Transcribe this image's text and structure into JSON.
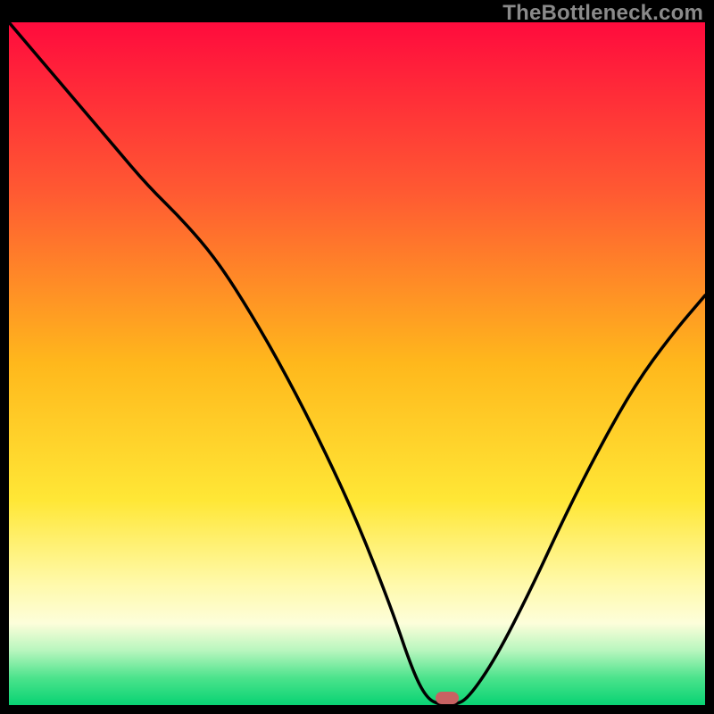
{
  "watermark": "TheBottleneck.com",
  "chart_data": {
    "type": "line",
    "title": "",
    "xlabel": "",
    "ylabel": "",
    "xlim": [
      0,
      100
    ],
    "ylim": [
      0,
      100
    ],
    "gradient_stops": [
      {
        "offset": 0,
        "color": "#ff0b3d"
      },
      {
        "offset": 25,
        "color": "#ff5a32"
      },
      {
        "offset": 50,
        "color": "#ffb81c"
      },
      {
        "offset": 70,
        "color": "#ffe736"
      },
      {
        "offset": 82,
        "color": "#fff9a8"
      },
      {
        "offset": 88,
        "color": "#fdfeda"
      },
      {
        "offset": 92,
        "color": "#b8f6be"
      },
      {
        "offset": 96,
        "color": "#4ce38c"
      },
      {
        "offset": 100,
        "color": "#08d373"
      }
    ],
    "series": [
      {
        "name": "bottleneck-curve",
        "x": [
          0,
          5,
          10,
          15,
          20,
          25,
          30,
          35,
          40,
          45,
          50,
          55,
          58,
          60,
          62,
          64,
          66,
          70,
          75,
          80,
          85,
          90,
          95,
          100
        ],
        "values": [
          100,
          94,
          88,
          82,
          76,
          71,
          65,
          57,
          48,
          38,
          27,
          14,
          5,
          1,
          0,
          0,
          1,
          7,
          17,
          28,
          38,
          47,
          54,
          60
        ]
      }
    ],
    "marker": {
      "x": 63,
      "y": 1,
      "color": "#c86262"
    }
  }
}
